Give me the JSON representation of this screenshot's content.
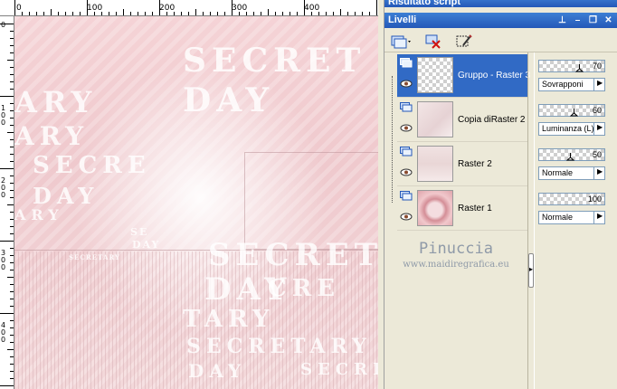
{
  "panel_titles": {
    "script": "Risultato script",
    "layers": "Livelli"
  },
  "ruler": {
    "top_labels": [
      "0",
      "100",
      "200",
      "300",
      "400"
    ],
    "left_labels": [
      "0",
      "1\n0\n0",
      "2\n0\n0",
      "3\n0\n0",
      "4\n0\n0"
    ]
  },
  "canvas_text": {
    "secret": "SECRET",
    "day": "DAY",
    "secretary": "SECRETARY",
    "ary": "ARY",
    "tary": "TARY",
    "secre": "SECRE",
    "se": "SE",
    "cre": "CRE",
    "small_secretary": "SECRETARY",
    "small_day": "DAY",
    "small_sec": "SE",
    "small_cre": "CRE"
  },
  "layers": [
    {
      "name": "Gruppo - Raster 3",
      "selected": true,
      "opacity": "70",
      "blend": "Sovrapponi"
    },
    {
      "name": "Copia diRaster 2",
      "selected": false,
      "opacity": "60",
      "blend": "Luminanza (L)"
    },
    {
      "name": "Raster 2",
      "selected": false,
      "opacity": "50",
      "blend": "Normale"
    },
    {
      "name": "Raster 1",
      "selected": false,
      "opacity": "100",
      "blend": "Normale"
    }
  ],
  "watermark": {
    "name": "Pinuccia",
    "url": "www.maidiregrafica.eu"
  },
  "colors": {
    "title_bar": "#2458b8",
    "selected_row": "#316ac5",
    "canvas_pink": "#efc9cd",
    "watermark_text": "#8f9aa8"
  }
}
